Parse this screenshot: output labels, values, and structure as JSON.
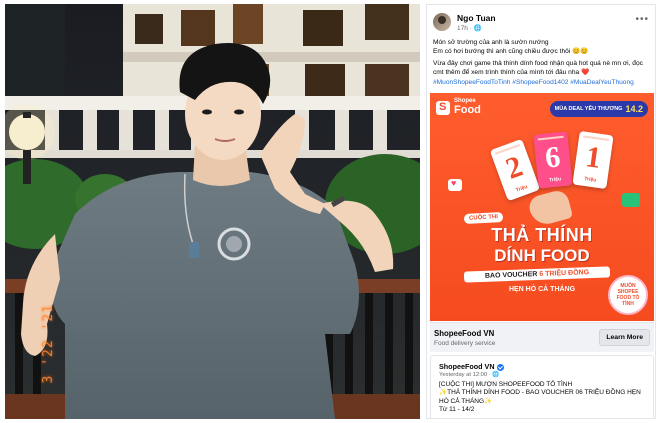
{
  "photo": {
    "date_stamp": "3 '22 '21",
    "description_icon": "portrait-photo"
  },
  "post": {
    "author": "Ngo Tuan",
    "time": "17h",
    "privacy_icon": "globe-icon",
    "caption_lines": [
      "Món sở trường của anh là sườn nướng",
      "Em có hơi bướng thì anh cũng chiều được thôi 😊😊",
      "Vừa đây chơi game thả thính dính food nhận quà hot quá nè mn ơi, đọc cmt thêm để xem trình thính của mình tới đâu nha ❤️"
    ],
    "hashtags": "#MuonShopeeFoodToTinh #ShopeeFood1402 #MuaDealYeuThuong"
  },
  "promo": {
    "brand_top": "Shopee",
    "brand_bottom": "Food",
    "deal_label": "MÙA DEAL YÊU THƯƠNG",
    "deal_date": "14.2",
    "tickets": [
      {
        "num": "2",
        "unit": "Triệu"
      },
      {
        "num": "6",
        "unit": "Triệu"
      },
      {
        "num": "1",
        "unit": "Triệu"
      }
    ],
    "contest_tag": "CUỘC THI",
    "headline1": "THẢ THÍNH",
    "headline2": "DÍNH FOOD",
    "voucher_prefix": "BAO VOUCHER ",
    "voucher_highlight": "6 TRIỆU ĐỒNG",
    "date_line": "HẸN HÒ CẢ THÁNG",
    "sticker_text": "MUỐN SHOPEE FOOD TỎ TÌNH"
  },
  "link_card": {
    "page_name": "ShopeeFood VN",
    "category": "Food delivery service",
    "learn_more": "Learn More"
  },
  "shared_post": {
    "page_name": "ShopeeFood VN",
    "meta": "Yesterday at 12:00 · ",
    "text_lines": [
      "[CUỘC THI] MƯỢN SHOPEEFOOD TỎ TÌNH",
      "✨THẢ THÍNH DÍNH FOOD - BAO VOUCHER 06 TRIỆU ĐỒNG HẸN HÒ CẢ THÁNG✨",
      "Từ 11 - 14/2"
    ]
  },
  "colors": {
    "shopee_orange": "#ee4d2d",
    "link_blue": "#216fdb",
    "facebook_blue": "#1877f2",
    "deal_navy": "#2b3aa8"
  }
}
